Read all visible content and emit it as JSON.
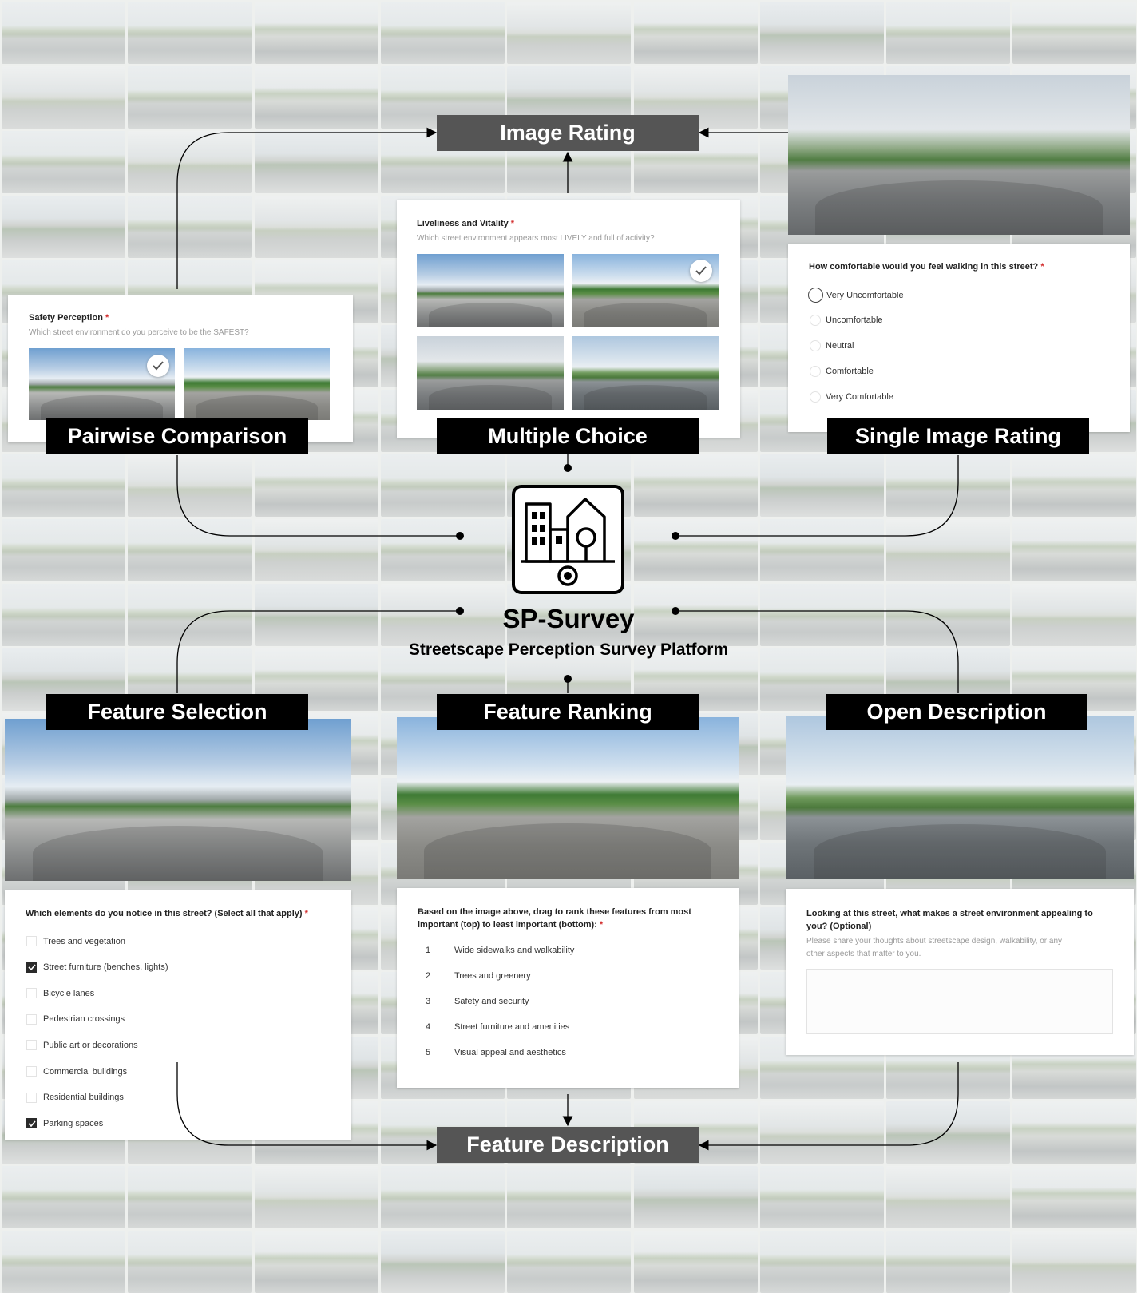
{
  "platform": {
    "name": "SP-Survey",
    "subtitle": "Streetscape Perception Survey Platform"
  },
  "labels": {
    "image_rating": "Image Rating",
    "pairwise": "Pairwise Comparison",
    "multiple_choice": "Multiple Choice",
    "single_image": "Single Image Rating",
    "feature_selection": "Feature Selection",
    "feature_ranking": "Feature Ranking",
    "open_description": "Open Description",
    "feature_description": "Feature Description"
  },
  "pairwise": {
    "title": "Safety Perception",
    "required": "*",
    "question": "Which street environment do you perceive to be the SAFEST?"
  },
  "multiple_choice": {
    "title": "Liveliness and Vitality",
    "required": "*",
    "question": "Which street environment appears most LIVELY and full of activity?"
  },
  "single_rating": {
    "question": "How comfortable would you feel walking in this street?",
    "required": "*",
    "options": [
      "Very Uncomfortable",
      "Uncomfortable",
      "Neutral",
      "Comfortable",
      "Very Comfortable"
    ]
  },
  "feature_selection": {
    "question": "Which elements do you notice in this street? (Select all that apply)",
    "required": "*",
    "options": [
      {
        "label": "Trees and vegetation",
        "checked": false
      },
      {
        "label": "Street furniture (benches, lights)",
        "checked": true
      },
      {
        "label": "Bicycle lanes",
        "checked": false
      },
      {
        "label": "Pedestrian crossings",
        "checked": false
      },
      {
        "label": "Public art or decorations",
        "checked": false
      },
      {
        "label": "Commercial buildings",
        "checked": false
      },
      {
        "label": "Residential buildings",
        "checked": false
      },
      {
        "label": "Parking spaces",
        "checked": true
      }
    ]
  },
  "feature_ranking": {
    "question_line1": "Based on the image above, drag to rank these features from most",
    "question_line2": "important (top) to least important (bottom):",
    "required": "*",
    "items": [
      {
        "rank": "1",
        "label": "Wide sidewalks and walkability"
      },
      {
        "rank": "2",
        "label": "Trees and greenery"
      },
      {
        "rank": "3",
        "label": "Safety and security"
      },
      {
        "rank": "4",
        "label": "Street furniture and amenities"
      },
      {
        "rank": "5",
        "label": "Visual appeal and aesthetics"
      }
    ]
  },
  "open_description": {
    "question_line1": "Looking at this street, what makes a street environment appealing to",
    "question_line2": "you? (Optional)",
    "hint_line1": "Please share your thoughts about streetscape design, walkability, or any",
    "hint_line2": "other aspects that matter to you."
  }
}
